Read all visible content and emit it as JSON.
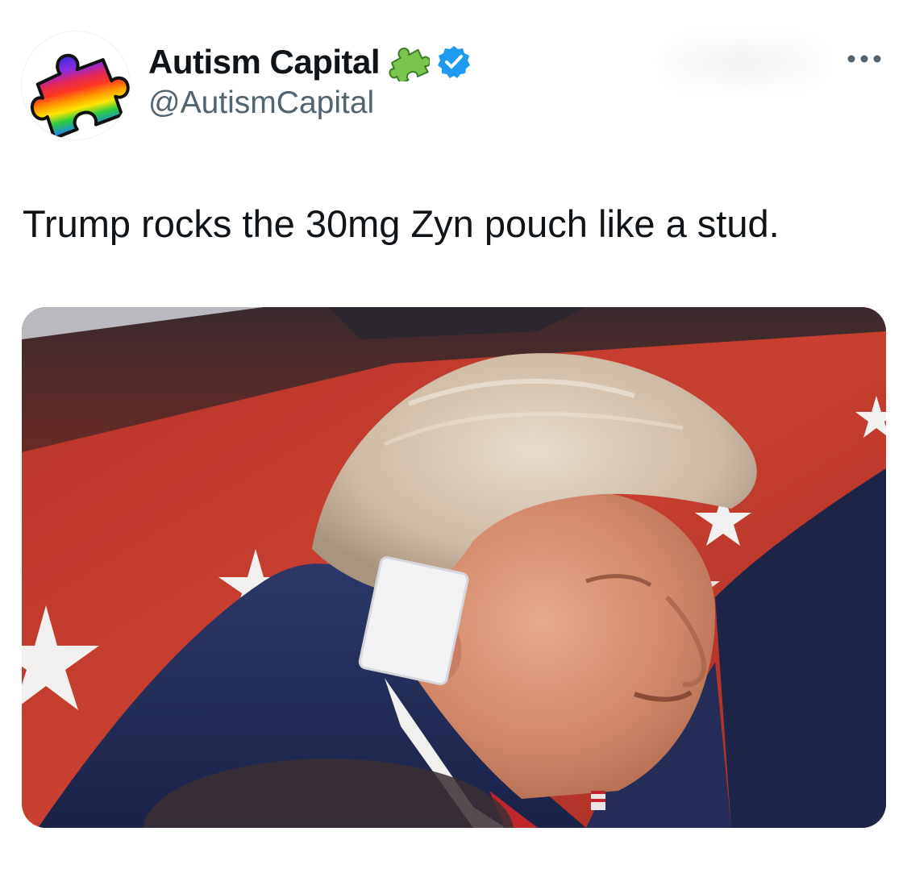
{
  "author": {
    "display_name": "Autism Capital",
    "handle": "@AutismCapital",
    "avatar_icon": "rainbow-puzzle-piece-icon",
    "name_emoji": "puzzle-piece-icon",
    "verified_icon": "verified-badge-icon"
  },
  "tweet": {
    "text": "Trump rocks the 30mg Zyn pouch like a stud."
  },
  "media": {
    "icon": "photo-image"
  },
  "actions": {
    "more_icon": "more-options-icon"
  },
  "colors": {
    "name": "#0f1419",
    "handle": "#536471",
    "verified": "#1d9bf0",
    "flag_red": "#c0392b",
    "suit_navy": "#1f2a52"
  }
}
